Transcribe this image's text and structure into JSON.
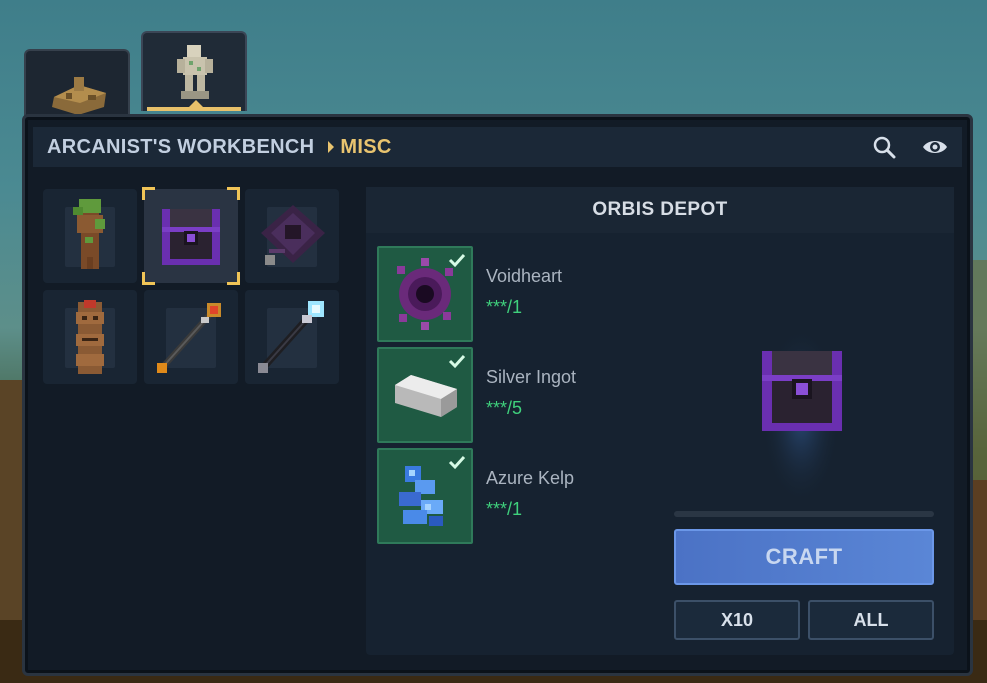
{
  "header": {
    "workbench_label": "ARCANIST'S WORKBENCH",
    "category_label": "MISC",
    "icons": [
      "search-icon",
      "eye-icon"
    ]
  },
  "tabs": [
    {
      "icon": "rubble-bench-icon",
      "active": false
    },
    {
      "icon": "arcane-statue-icon",
      "active": true
    }
  ],
  "grid": {
    "items": [
      {
        "icon": "mossy-totem-icon",
        "selected": false
      },
      {
        "icon": "void-chest-icon",
        "selected": true
      },
      {
        "icon": "void-glider-icon",
        "selected": false
      },
      {
        "icon": "wooden-totem-icon",
        "selected": false
      },
      {
        "icon": "fire-staff-icon",
        "selected": false
      },
      {
        "icon": "ice-staff-icon",
        "selected": false
      }
    ]
  },
  "recipe": {
    "title": "ORBIS DEPOT",
    "ingredients": [
      {
        "name": "Voidheart",
        "qty": "***/1",
        "icon": "voidheart-icon",
        "satisfied": true
      },
      {
        "name": "Silver Ingot",
        "qty": "***/5",
        "icon": "silver-ingot-icon",
        "satisfied": true
      },
      {
        "name": "Azure Kelp",
        "qty": "***/1",
        "icon": "azure-kelp-icon",
        "satisfied": true
      }
    ],
    "preview_icon": "void-chest-icon",
    "progress": 0,
    "craft_label": "CRAFT",
    "x10_label": "X10",
    "all_label": "ALL"
  },
  "colors": {
    "accent_gold": "#e9c46f",
    "satisfied_green": "#3fd07c",
    "craft_blue": "#5a86d6"
  }
}
